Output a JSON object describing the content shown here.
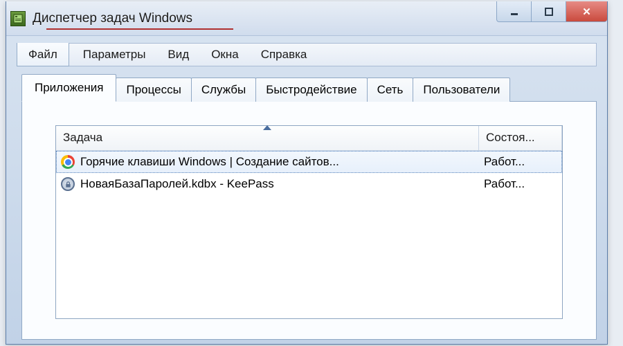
{
  "window": {
    "title": "Диспетчер задач Windows"
  },
  "menu": {
    "items": [
      {
        "label": "Файл"
      },
      {
        "label": "Параметры"
      },
      {
        "label": "Вид"
      },
      {
        "label": "Окна"
      },
      {
        "label": "Справка"
      }
    ]
  },
  "tabs": [
    {
      "label": "Приложения",
      "active": true
    },
    {
      "label": "Процессы"
    },
    {
      "label": "Службы"
    },
    {
      "label": "Быстродействие"
    },
    {
      "label": "Сеть"
    },
    {
      "label": "Пользователи"
    }
  ],
  "columns": {
    "task": "Задача",
    "status": "Состоя..."
  },
  "rows": [
    {
      "icon": "chrome",
      "task": "Горячие клавиши Windows | Создание сайтов...",
      "status": "Работ...",
      "selected": true
    },
    {
      "icon": "lock",
      "task": "НоваяБазаПаролей.kdbx - KeePass",
      "status": "Работ...",
      "selected": false
    }
  ]
}
